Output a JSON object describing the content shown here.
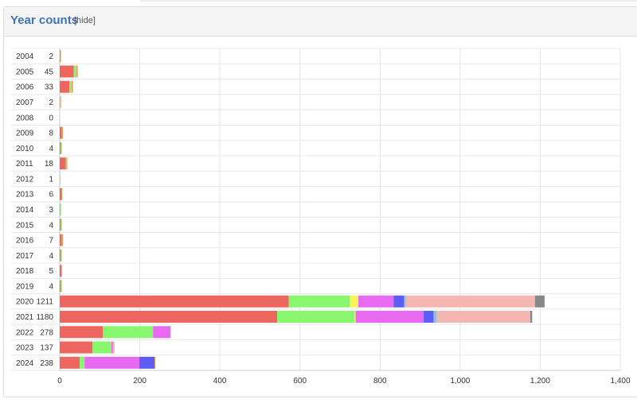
{
  "header": {
    "title": "Year counts",
    "hide_label": "[hide]"
  },
  "chart_data": {
    "type": "bar",
    "orientation": "horizontal",
    "stacked": true,
    "grid": true,
    "xlim": [
      0,
      1400
    ],
    "x_ticks": [
      "0",
      "200",
      "400",
      "600",
      "800",
      "1,000",
      "1,200",
      "1,400"
    ],
    "x_tick_values": [
      0,
      200,
      400,
      600,
      800,
      1000,
      1200,
      1400
    ],
    "categories": [
      "2004",
      "2005",
      "2006",
      "2007",
      "2008",
      "2009",
      "2010",
      "2011",
      "2012",
      "2013",
      "2014",
      "2015",
      "2016",
      "2017",
      "2018",
      "2019",
      "2020",
      "2021",
      "2022",
      "2023",
      "2024"
    ],
    "totals": [
      "2",
      "45",
      "33",
      "2",
      "0",
      "8",
      "4",
      "18",
      "1",
      "6",
      "3",
      "4",
      "7",
      "4",
      "5",
      "4",
      "1211",
      "1180",
      "278",
      "137",
      "238"
    ],
    "series": [
      {
        "color": "#ee6660",
        "values": [
          1,
          35,
          24,
          0,
          0,
          5,
          2,
          15,
          0,
          5,
          1,
          2,
          5,
          2,
          4,
          2,
          572,
          543,
          108,
          82,
          50
        ]
      },
      {
        "color": "#88f76e",
        "values": [
          0,
          7,
          6,
          1,
          0,
          1,
          1,
          2,
          1,
          1,
          2,
          1,
          1,
          1,
          1,
          1,
          153,
          193,
          125,
          47,
          12
        ]
      },
      {
        "color": "#f9f35a",
        "values": [
          0,
          0,
          0,
          0,
          0,
          0,
          0,
          0,
          0,
          0,
          0,
          0,
          0,
          0,
          0,
          0,
          21,
          3,
          0,
          0,
          0
        ]
      },
      {
        "color": "#e86af0",
        "values": [
          0,
          0,
          0,
          0,
          0,
          0,
          0,
          0,
          0,
          0,
          0,
          0,
          0,
          0,
          0,
          0,
          88,
          170,
          44,
          3,
          137
        ]
      },
      {
        "color": "#5d5cf5",
        "values": [
          0,
          0,
          0,
          0,
          0,
          0,
          0,
          0,
          0,
          0,
          0,
          0,
          0,
          0,
          0,
          0,
          26,
          25,
          0,
          0,
          38
        ]
      },
      {
        "color": "#8fc2d8",
        "values": [
          0,
          0,
          0,
          0,
          0,
          0,
          0,
          0,
          0,
          0,
          0,
          0,
          0,
          0,
          0,
          0,
          4,
          8,
          0,
          0,
          0
        ]
      },
      {
        "color": "#e99a50",
        "values": [
          1,
          3,
          3,
          1,
          0,
          2,
          1,
          1,
          0,
          0,
          0,
          1,
          1,
          1,
          0,
          1,
          0,
          0,
          0,
          1,
          1
        ]
      },
      {
        "color": "#f5b5b2",
        "values": [
          0,
          0,
          0,
          0,
          0,
          0,
          0,
          0,
          0,
          0,
          0,
          0,
          0,
          0,
          0,
          0,
          323,
          233,
          0,
          4,
          0
        ]
      },
      {
        "color": "#888888",
        "values": [
          0,
          0,
          0,
          0,
          0,
          0,
          0,
          0,
          0,
          0,
          0,
          0,
          0,
          0,
          0,
          0,
          24,
          5,
          0,
          0,
          0
        ]
      }
    ]
  }
}
